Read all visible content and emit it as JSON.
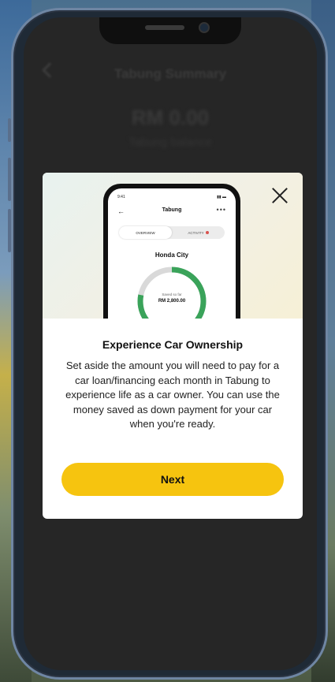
{
  "background_screen": {
    "header_title": "Tabung Summary",
    "amount": "RM 0.00",
    "subtitle": "Tabung balance"
  },
  "modal": {
    "close_label": "",
    "illustration": {
      "status_time": "9:41",
      "status_icons": "▮▮ ▬",
      "back_glyph": "←",
      "title": "Tabung",
      "more_glyph": "•••",
      "tabs": [
        {
          "label": "OVERVIEW",
          "active": true
        },
        {
          "label": "ACTIVITY",
          "active": false
        }
      ],
      "car_name": "Honda City",
      "ring_progress": 0.78,
      "ring_label": "Saved so far",
      "ring_amount": "RM 2,800.00"
    },
    "title": "Experience Car Ownership",
    "body": "Set aside the amount you will need to pay for a car loan/financing each month in Tabung to experience life as a car owner. You can use the money saved as down payment for your car when you're ready.",
    "next_label": "Next"
  },
  "colors": {
    "accent": "#f6c40f",
    "ring_green": "#3aa35a",
    "ring_track": "#d9d9d9",
    "overlay_dark": "#262626"
  }
}
